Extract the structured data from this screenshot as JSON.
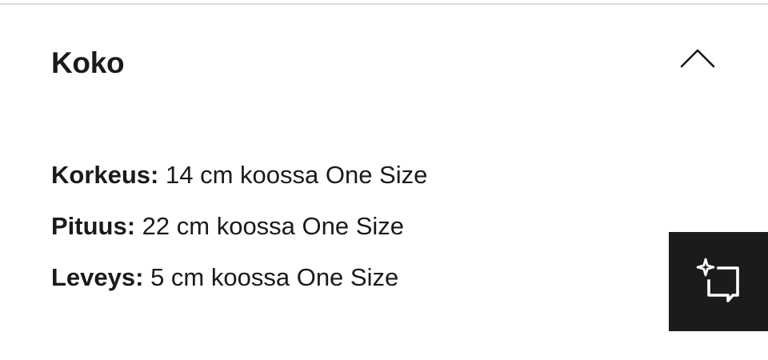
{
  "section": {
    "title": "Koko",
    "toggle_icon": "chevron-up-icon",
    "expanded": true
  },
  "details": [
    {
      "label": "Korkeus:",
      "value": "14 cm koossa One Size"
    },
    {
      "label": "Pituus:",
      "value": "22 cm koossa One Size"
    },
    {
      "label": "Leveys:",
      "value": "5 cm koossa One Size"
    }
  ],
  "floating_button": {
    "icon": "sparkle-chat-icon",
    "background": "#1b1b1b",
    "icon_color": "#ffffff"
  },
  "colors": {
    "text": "#1a1a1a",
    "divider": "#d6dbdb",
    "background": "#ffffff"
  }
}
